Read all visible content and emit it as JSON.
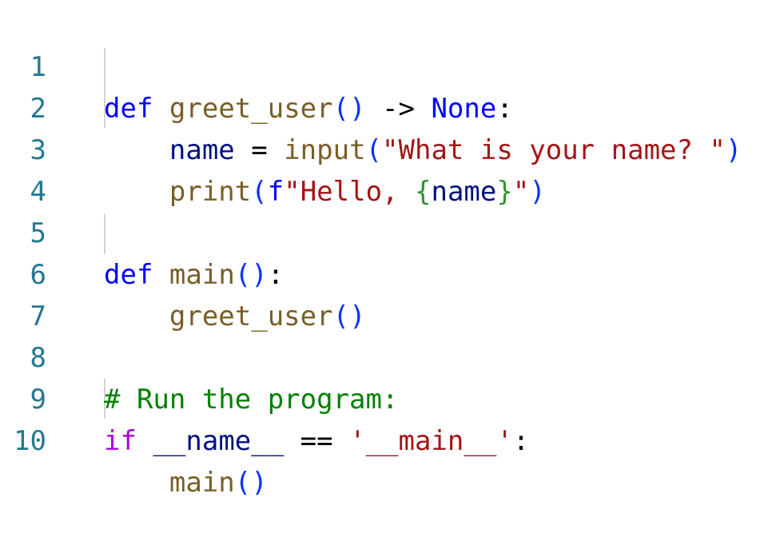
{
  "editor": {
    "lines": [
      {
        "number": "1",
        "tokens": [
          {
            "text": "def",
            "kind": "keyword"
          },
          {
            "text": " ",
            "kind": "op"
          },
          {
            "text": "greet_user",
            "kind": "func"
          },
          {
            "text": "()",
            "kind": "paren"
          },
          {
            "text": " -> ",
            "kind": "op"
          },
          {
            "text": "None",
            "kind": "keyword"
          },
          {
            "text": ":",
            "kind": "op"
          }
        ]
      },
      {
        "number": "2",
        "tokens": [
          {
            "text": "    ",
            "kind": "op"
          },
          {
            "text": "name",
            "kind": "var"
          },
          {
            "text": " = ",
            "kind": "op"
          },
          {
            "text": "input",
            "kind": "func"
          },
          {
            "text": "(",
            "kind": "paren"
          },
          {
            "text": "\"What is your name? \"",
            "kind": "string"
          },
          {
            "text": ")",
            "kind": "paren"
          }
        ]
      },
      {
        "number": "3",
        "tokens": [
          {
            "text": "    ",
            "kind": "op"
          },
          {
            "text": "print",
            "kind": "func"
          },
          {
            "text": "(",
            "kind": "paren"
          },
          {
            "text": "f",
            "kind": "keyword"
          },
          {
            "text": "\"Hello, ",
            "kind": "string"
          },
          {
            "text": "{",
            "kind": "brace"
          },
          {
            "text": "name",
            "kind": "var"
          },
          {
            "text": "}",
            "kind": "brace"
          },
          {
            "text": "\"",
            "kind": "string"
          },
          {
            "text": ")",
            "kind": "paren"
          }
        ]
      },
      {
        "number": "4",
        "tokens": []
      },
      {
        "number": "5",
        "tokens": [
          {
            "text": "def",
            "kind": "keyword"
          },
          {
            "text": " ",
            "kind": "op"
          },
          {
            "text": "main",
            "kind": "func"
          },
          {
            "text": "()",
            "kind": "paren"
          },
          {
            "text": ":",
            "kind": "op"
          }
        ]
      },
      {
        "number": "6",
        "tokens": [
          {
            "text": "    ",
            "kind": "op"
          },
          {
            "text": "greet_user",
            "kind": "func"
          },
          {
            "text": "()",
            "kind": "paren"
          }
        ]
      },
      {
        "number": "7",
        "tokens": []
      },
      {
        "number": "8",
        "tokens": [
          {
            "text": "# Run the program:",
            "kind": "comment"
          }
        ]
      },
      {
        "number": "9",
        "tokens": [
          {
            "text": "if",
            "kind": "control"
          },
          {
            "text": " ",
            "kind": "op"
          },
          {
            "text": "__name__",
            "kind": "var"
          },
          {
            "text": " == ",
            "kind": "op"
          },
          {
            "text": "'__main__'",
            "kind": "string"
          },
          {
            "text": ":",
            "kind": "op"
          }
        ]
      },
      {
        "number": "10",
        "tokens": [
          {
            "text": "    ",
            "kind": "op"
          },
          {
            "text": "main",
            "kind": "func"
          },
          {
            "text": "()",
            "kind": "paren"
          }
        ]
      }
    ]
  },
  "colors": {
    "background": "#ffffff",
    "line_number": "#237893",
    "keyword": "#0000ff",
    "control": "#af00db",
    "function": "#795e26",
    "variable": "#001080",
    "string": "#a31515",
    "paren": "#0431fa",
    "brace": "#319331",
    "comment": "#008000",
    "indent_guide": "#d3d3d3"
  }
}
